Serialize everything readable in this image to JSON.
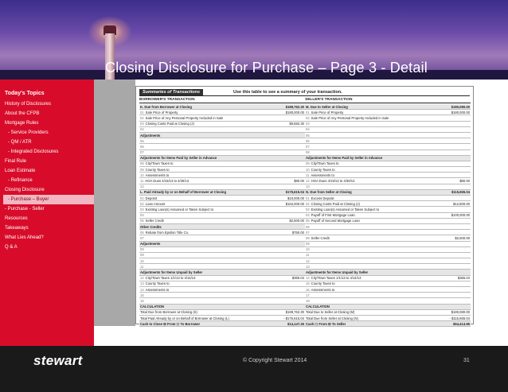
{
  "slide_title": "Closing Disclosure for Purchase – Page 3 - Detail",
  "sidebar": {
    "heading": "Today's Topics",
    "items": [
      {
        "label": "History of Disclosures",
        "sub": false,
        "active": false
      },
      {
        "label": "About the CFPB",
        "sub": false,
        "active": false
      },
      {
        "label": "Mortgage Rules",
        "sub": false,
        "active": false
      },
      {
        "label": "- Service Providers",
        "sub": true,
        "active": false
      },
      {
        "label": "- QM / ATR",
        "sub": true,
        "active": false
      },
      {
        "label": "- Integrated Disclosures",
        "sub": true,
        "active": false
      },
      {
        "label": "Final Rule",
        "sub": false,
        "active": false
      },
      {
        "label": "Loan Estimate",
        "sub": false,
        "active": false
      },
      {
        "label": "- Refinance",
        "sub": true,
        "active": false
      },
      {
        "label": "Closing Disclosure",
        "sub": false,
        "active": false
      },
      {
        "label": "- Purchase – Buyer",
        "sub": true,
        "active": true
      },
      {
        "label": "- Purchase - Seller",
        "sub": false,
        "active": false
      },
      {
        "label": "Resources",
        "sub": false,
        "active": false
      },
      {
        "label": "Takeaways",
        "sub": false,
        "active": false
      },
      {
        "label": "What Lies Ahead?",
        "sub": false,
        "active": false
      },
      {
        "label": "Q & A",
        "sub": false,
        "active": false
      }
    ]
  },
  "document": {
    "section": "Summaries of Transactions",
    "hint": "Use this table to see a summary of your transaction.",
    "borrower": {
      "title": "BORROWER'S TRANSACTION",
      "rows": [
        {
          "n": "",
          "lbl": "K. Due from Borrower at Closing",
          "amt": "$189,762.30",
          "bold": true
        },
        {
          "n": "01",
          "lbl": "Sale Price of Property",
          "amt": "$180,000.00"
        },
        {
          "n": "02",
          "lbl": "Sale Price of Any Personal Property Included in Sale",
          "amt": ""
        },
        {
          "n": "03",
          "lbl": "Closing Costs Paid at Closing (J)",
          "amt": "$9,682.30"
        },
        {
          "n": "04",
          "lbl": "",
          "amt": ""
        },
        {
          "n": "",
          "lbl": "Adjustments",
          "amt": "",
          "bold": true
        },
        {
          "n": "05",
          "lbl": "",
          "amt": ""
        },
        {
          "n": "06",
          "lbl": "",
          "amt": ""
        },
        {
          "n": "07",
          "lbl": "",
          "amt": ""
        },
        {
          "n": "",
          "lbl": "Adjustments for Items Paid by Seller in Advance",
          "amt": "",
          "bold": true
        },
        {
          "n": "08",
          "lbl": "City/Town Taxes        to",
          "amt": ""
        },
        {
          "n": "09",
          "lbl": "County Taxes           to",
          "amt": ""
        },
        {
          "n": "10",
          "lbl": "Assessments            to",
          "amt": ""
        },
        {
          "n": "11",
          "lbl": "HOA Dues    4/15/13   to   4/30/13",
          "amt": "$80.00"
        },
        {
          "n": "12",
          "lbl": "",
          "amt": ""
        },
        {
          "n": "",
          "lbl": "L. Paid Already by or on Behalf of Borrower at Closing",
          "amt": "$175,615.04",
          "bold": true
        },
        {
          "n": "01",
          "lbl": "Deposit",
          "amt": "$10,000.00"
        },
        {
          "n": "02",
          "lbl": "Loan Amount",
          "amt": "$162,000.00"
        },
        {
          "n": "03",
          "lbl": "Existing Loan(s) Assumed or Taken Subject to",
          "amt": ""
        },
        {
          "n": "04",
          "lbl": "",
          "amt": ""
        },
        {
          "n": "05",
          "lbl": "Seller Credit",
          "amt": "$2,500.00"
        },
        {
          "n": "",
          "lbl": "Other Credits",
          "amt": "",
          "bold": true
        },
        {
          "n": "06",
          "lbl": "Rebate from Epsilon Title Co.",
          "amt": "$750.00"
        },
        {
          "n": "07",
          "lbl": "",
          "amt": ""
        },
        {
          "n": "",
          "lbl": "Adjustments",
          "amt": "",
          "bold": true
        },
        {
          "n": "08",
          "lbl": "",
          "amt": ""
        },
        {
          "n": "09",
          "lbl": "",
          "amt": ""
        },
        {
          "n": "10",
          "lbl": "",
          "amt": ""
        },
        {
          "n": "11",
          "lbl": "",
          "amt": ""
        },
        {
          "n": "",
          "lbl": "Adjustments for Items Unpaid by Seller",
          "amt": "",
          "bold": true
        },
        {
          "n": "12",
          "lbl": "City/Town Taxes  1/1/13  to  4/14/13",
          "amt": "$365.04"
        },
        {
          "n": "13",
          "lbl": "County Taxes           to",
          "amt": ""
        },
        {
          "n": "14",
          "lbl": "Assessments            to",
          "amt": ""
        },
        {
          "n": "15",
          "lbl": "",
          "amt": ""
        },
        {
          "n": "16",
          "lbl": "",
          "amt": ""
        },
        {
          "n": "",
          "lbl": "CALCULATION",
          "amt": "",
          "bold": true
        },
        {
          "n": "",
          "lbl": "Total Due from Borrower at Closing (K)",
          "amt": "$189,762.30"
        },
        {
          "n": "",
          "lbl": "Total Paid Already by or on Behalf of Borrower at Closing (L)",
          "amt": "- $175,615.04"
        },
        {
          "n": "",
          "lbl": "Cash to Close  ☒ From  ☐ To Borrower",
          "amt": "$14,147.26",
          "bold": true
        }
      ]
    },
    "seller": {
      "title": "SELLER'S TRANSACTION",
      "rows": [
        {
          "n": "",
          "lbl": "M. Due to Seller at Closing",
          "amt": "$180,080.00",
          "bold": true
        },
        {
          "n": "01",
          "lbl": "Sale Price of Property",
          "amt": "$180,000.00"
        },
        {
          "n": "02",
          "lbl": "Sale Price of Any Personal Property Included in Sale",
          "amt": ""
        },
        {
          "n": "03",
          "lbl": "",
          "amt": ""
        },
        {
          "n": "04",
          "lbl": "",
          "amt": ""
        },
        {
          "n": "05",
          "lbl": "",
          "amt": ""
        },
        {
          "n": "06",
          "lbl": "",
          "amt": ""
        },
        {
          "n": "07",
          "lbl": "",
          "amt": ""
        },
        {
          "n": "08",
          "lbl": "",
          "amt": ""
        },
        {
          "n": "",
          "lbl": "Adjustments for Items Paid by Seller in Advance",
          "amt": "",
          "bold": true
        },
        {
          "n": "09",
          "lbl": "City/Town Taxes        to",
          "amt": ""
        },
        {
          "n": "10",
          "lbl": "County Taxes           to",
          "amt": ""
        },
        {
          "n": "11",
          "lbl": "Assessments            to",
          "amt": ""
        },
        {
          "n": "12",
          "lbl": "HOA Dues    4/15/13   to   4/30/13",
          "amt": "$80.00"
        },
        {
          "n": "13",
          "lbl": "",
          "amt": ""
        },
        {
          "n": "",
          "lbl": "N. Due from Seller at Closing",
          "amt": "$115,665.04",
          "bold": true
        },
        {
          "n": "01",
          "lbl": "Excess Deposit",
          "amt": ""
        },
        {
          "n": "02",
          "lbl": "Closing Costs Paid at Closing (J)",
          "amt": "$12,800.00"
        },
        {
          "n": "03",
          "lbl": "Existing Loan(s) Assumed or Taken Subject to",
          "amt": ""
        },
        {
          "n": "04",
          "lbl": "Payoff of First Mortgage Loan",
          "amt": "$100,000.00"
        },
        {
          "n": "05",
          "lbl": "Payoff of Second Mortgage Loan",
          "amt": ""
        },
        {
          "n": "06",
          "lbl": "",
          "amt": ""
        },
        {
          "n": "07",
          "lbl": "",
          "amt": ""
        },
        {
          "n": "08",
          "lbl": "Seller Credit",
          "amt": "$2,500.00"
        },
        {
          "n": "09",
          "lbl": "",
          "amt": ""
        },
        {
          "n": "10",
          "lbl": "",
          "amt": ""
        },
        {
          "n": "11",
          "lbl": "",
          "amt": ""
        },
        {
          "n": "12",
          "lbl": "",
          "amt": ""
        },
        {
          "n": "13",
          "lbl": "",
          "amt": ""
        },
        {
          "n": "",
          "lbl": "Adjustments for Items Unpaid by Seller",
          "amt": "",
          "bold": true
        },
        {
          "n": "14",
          "lbl": "City/Town Taxes  1/1/13  to  4/14/13",
          "amt": "$365.04"
        },
        {
          "n": "15",
          "lbl": "County Taxes           to",
          "amt": ""
        },
        {
          "n": "16",
          "lbl": "Assessments            to",
          "amt": ""
        },
        {
          "n": "17",
          "lbl": "",
          "amt": ""
        },
        {
          "n": "18",
          "lbl": "",
          "amt": ""
        },
        {
          "n": "",
          "lbl": "CALCULATION",
          "amt": "",
          "bold": true
        },
        {
          "n": "",
          "lbl": "Total Due to Seller at Closing (M)",
          "amt": "$180,080.00"
        },
        {
          "n": "",
          "lbl": "Total Due from Seller at Closing (N)",
          "amt": "- $115,665.04"
        },
        {
          "n": "",
          "lbl": "Cash  ☐ From  ☒ To Seller",
          "amt": "$64,414.96",
          "bold": true
        }
      ]
    }
  },
  "footer": {
    "logo": "stewart",
    "copyright": "© Copyright Stewart 2014",
    "page": "31"
  }
}
